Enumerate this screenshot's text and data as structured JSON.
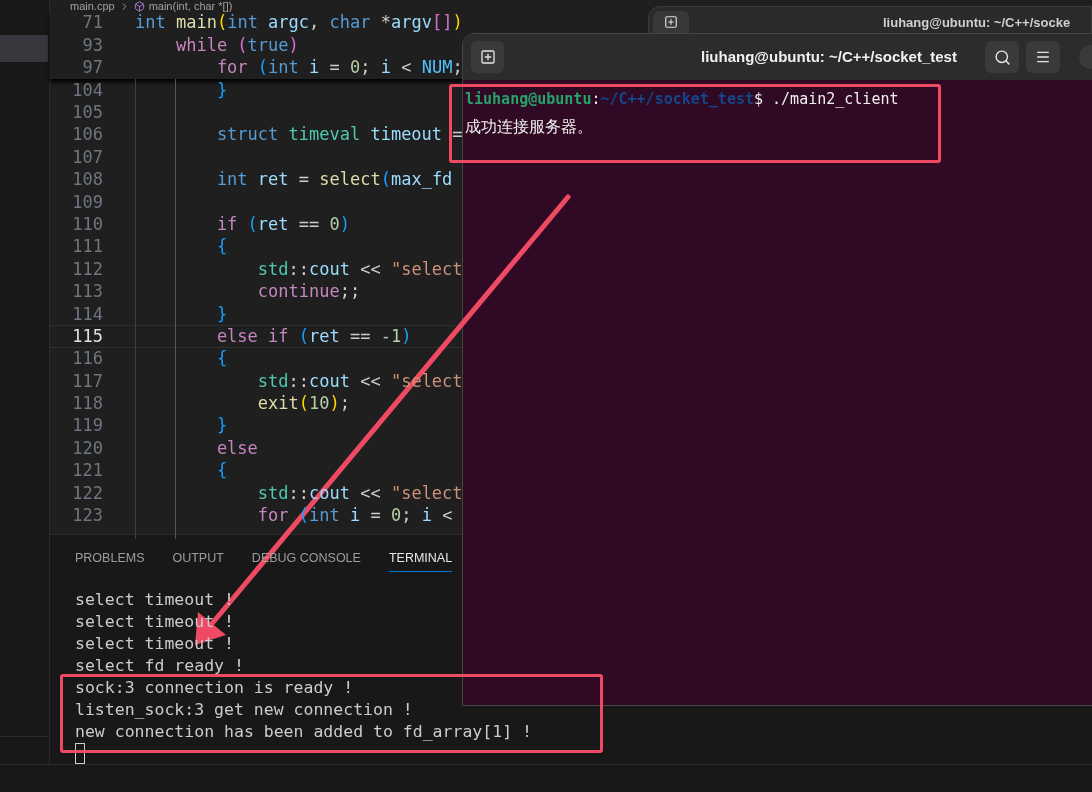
{
  "editor": {
    "breadcrumb": [
      "main.cpp",
      "main(int, char *[])"
    ],
    "sticky_lines": [
      {
        "number": "71",
        "tokens": [
          {
            "text": "int",
            "kind": "keyword"
          },
          {
            "text": " main",
            "kind": "function"
          },
          {
            "text": "(",
            "kind": "bracket-gold"
          },
          {
            "text": "int",
            "kind": "keyword"
          },
          {
            "text": " argc",
            "kind": "variable"
          },
          {
            "text": ",",
            "kind": "plain"
          },
          {
            "text": " char",
            "kind": "keyword"
          },
          {
            "text": " *",
            "kind": "plain"
          },
          {
            "text": "argv",
            "kind": "variable"
          },
          {
            "text": "[]",
            "kind": "bracket-orchid"
          },
          {
            "text": ")",
            "kind": "bracket-gold"
          }
        ]
      },
      {
        "number": "93",
        "tokens": [
          {
            "text": "    while",
            "kind": "control"
          },
          {
            "text": " (",
            "kind": "bracket-orchid"
          },
          {
            "text": "true",
            "kind": "keyword"
          },
          {
            "text": ")",
            "kind": "bracket-orchid"
          }
        ]
      },
      {
        "number": "97",
        "tokens": [
          {
            "text": "        for",
            "kind": "control"
          },
          {
            "text": " (",
            "kind": "bracket-blue"
          },
          {
            "text": "int",
            "kind": "keyword"
          },
          {
            "text": " i",
            "kind": "variable"
          },
          {
            "text": " =",
            "kind": "plain"
          },
          {
            "text": " 0",
            "kind": "number"
          },
          {
            "text": ";",
            "kind": "plain"
          },
          {
            "text": " i",
            "kind": "variable"
          },
          {
            "text": " <",
            "kind": "plain"
          },
          {
            "text": " NUM",
            "kind": "constant"
          },
          {
            "text": ";",
            "kind": "plain"
          }
        ]
      }
    ],
    "lines": [
      {
        "number": "104",
        "current": false,
        "tokens": [
          {
            "text": "        }",
            "kind": "bracket-blue"
          }
        ]
      },
      {
        "number": "105",
        "current": false
      },
      {
        "number": "106",
        "current": false,
        "tokens": [
          {
            "text": "        struct",
            "kind": "keyword"
          },
          {
            "text": " timeval",
            "kind": "type"
          },
          {
            "text": " timeout",
            "kind": "variable"
          },
          {
            "text": " =",
            "kind": "plain"
          }
        ]
      },
      {
        "number": "107",
        "current": false
      },
      {
        "number": "108",
        "current": false,
        "tokens": [
          {
            "text": "        int",
            "kind": "keyword"
          },
          {
            "text": " ret",
            "kind": "variable"
          },
          {
            "text": " =",
            "kind": "plain"
          },
          {
            "text": " select",
            "kind": "function"
          },
          {
            "text": "(",
            "kind": "bracket-blue"
          },
          {
            "text": "max_fd",
            "kind": "variable"
          }
        ]
      },
      {
        "number": "109",
        "current": false
      },
      {
        "number": "110",
        "current": false,
        "tokens": [
          {
            "text": "        if",
            "kind": "control"
          },
          {
            "text": " (",
            "kind": "bracket-blue"
          },
          {
            "text": "ret",
            "kind": "variable"
          },
          {
            "text": " ==",
            "kind": "plain"
          },
          {
            "text": " 0",
            "kind": "number"
          },
          {
            "text": ")",
            "kind": "bracket-blue"
          }
        ]
      },
      {
        "number": "111",
        "current": false,
        "tokens": [
          {
            "text": "        {",
            "kind": "bracket-blue"
          }
        ]
      },
      {
        "number": "112",
        "current": false,
        "tokens": [
          {
            "text": "            std",
            "kind": "type"
          },
          {
            "text": "::",
            "kind": "plain"
          },
          {
            "text": "cout",
            "kind": "variable"
          },
          {
            "text": " <<",
            "kind": "plain"
          },
          {
            "text": " \"select",
            "kind": "string"
          }
        ]
      },
      {
        "number": "113",
        "current": false,
        "tokens": [
          {
            "text": "            continue",
            "kind": "control"
          },
          {
            "text": ";;",
            "kind": "plain"
          }
        ]
      },
      {
        "number": "114",
        "current": false,
        "tokens": [
          {
            "text": "        }",
            "kind": "bracket-blue"
          }
        ]
      },
      {
        "number": "115",
        "current": true,
        "tokens": [
          {
            "text": "        else if",
            "kind": "control"
          },
          {
            "text": " (",
            "kind": "bracket-blue"
          },
          {
            "text": "ret",
            "kind": "variable"
          },
          {
            "text": " ==",
            "kind": "plain"
          },
          {
            "text": " -1",
            "kind": "number"
          },
          {
            "text": ")",
            "kind": "bracket-blue"
          }
        ]
      },
      {
        "number": "116",
        "current": false,
        "tokens": [
          {
            "text": "        {",
            "kind": "bracket-blue"
          }
        ]
      },
      {
        "number": "117",
        "current": false,
        "tokens": [
          {
            "text": "            std",
            "kind": "type"
          },
          {
            "text": "::",
            "kind": "plain"
          },
          {
            "text": "cout",
            "kind": "variable"
          },
          {
            "text": " <<",
            "kind": "plain"
          },
          {
            "text": " \"select",
            "kind": "string"
          }
        ]
      },
      {
        "number": "118",
        "current": false,
        "tokens": [
          {
            "text": "            exit",
            "kind": "function"
          },
          {
            "text": "(",
            "kind": "bracket-gold"
          },
          {
            "text": "10",
            "kind": "number"
          },
          {
            "text": ")",
            "kind": "bracket-gold"
          },
          {
            "text": ";",
            "kind": "plain"
          }
        ]
      },
      {
        "number": "119",
        "current": false,
        "tokens": [
          {
            "text": "        }",
            "kind": "bracket-blue"
          }
        ]
      },
      {
        "number": "120",
        "current": false,
        "tokens": [
          {
            "text": "        else",
            "kind": "control"
          }
        ]
      },
      {
        "number": "121",
        "current": false,
        "tokens": [
          {
            "text": "        {",
            "kind": "bracket-blue"
          }
        ]
      },
      {
        "number": "122",
        "current": false,
        "tokens": [
          {
            "text": "            std",
            "kind": "type"
          },
          {
            "text": "::",
            "kind": "plain"
          },
          {
            "text": "cout",
            "kind": "variable"
          },
          {
            "text": " <<",
            "kind": "plain"
          },
          {
            "text": " \"select",
            "kind": "string"
          }
        ]
      },
      {
        "number": "123",
        "current": false,
        "tokens": [
          {
            "text": "            for",
            "kind": "control"
          },
          {
            "text": " (",
            "kind": "bracket-blue"
          },
          {
            "text": "int",
            "kind": "keyword"
          },
          {
            "text": " i",
            "kind": "variable"
          },
          {
            "text": " =",
            "kind": "plain"
          },
          {
            "text": " 0",
            "kind": "number"
          },
          {
            "text": ";",
            "kind": "plain"
          },
          {
            "text": " i",
            "kind": "variable"
          },
          {
            "text": " <",
            "kind": "plain"
          }
        ]
      }
    ]
  },
  "panel": {
    "tabs": [
      {
        "label": "PROBLEMS",
        "selected": false
      },
      {
        "label": "OUTPUT",
        "selected": false
      },
      {
        "label": "DEBUG CONSOLE",
        "selected": false
      },
      {
        "label": "TERMINAL",
        "selected": true
      }
    ],
    "output": [
      "select timeout !",
      "select timeout !",
      "select timeout !",
      "select fd ready !",
      "sock:3 connection is ready !",
      "listen_sock:3 get new connection !",
      "new connection has been added to fd_array[1] !"
    ]
  },
  "terminal_windows": [
    {
      "title": "liuhang@ubuntu: ~/C++/socke"
    },
    {
      "title": "liuhang@ubuntu: ~/C++/socket_test",
      "prompt": {
        "user_host": "liuhang@ubuntu",
        "separator": ":",
        "path": "~/C++/socket_test",
        "command": "$ ./main2_client"
      },
      "output": [
        "成功连接服务器。"
      ]
    }
  ]
}
